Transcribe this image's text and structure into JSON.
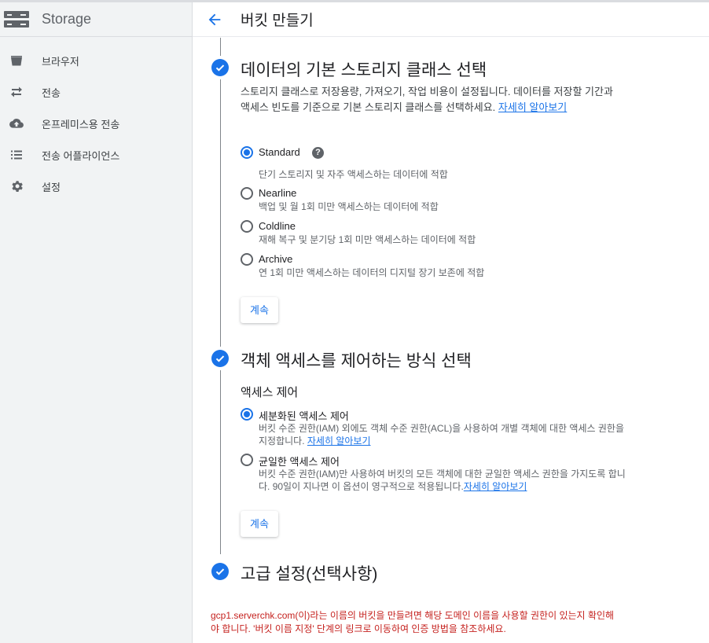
{
  "sidebar": {
    "title": "Storage",
    "items": [
      {
        "label": "브라우저",
        "icon": "bucket-icon"
      },
      {
        "label": "전송",
        "icon": "transfer-arrows-icon"
      },
      {
        "label": "온프레미스용 전송",
        "icon": "cloud-upload-icon"
      },
      {
        "label": "전송 어플라이언스",
        "icon": "list-icon"
      },
      {
        "label": "설정",
        "icon": "gear-icon"
      }
    ]
  },
  "header": {
    "title": "버킷 만들기"
  },
  "storage_class": {
    "title": "데이터의 기본 스토리지 클래스 선택",
    "description": "스토리지 클래스로 저장용량, 가져오기, 작업 비용이 설정됩니다. 데이터를 저장할 기간과 액세스 빈도를 기준으로 기본 스토리지 클래스를 선택하세요.",
    "learn_more": "자세히 알아보기",
    "options": [
      {
        "label": "Standard",
        "desc": "단기 스토리지 및 자주 액세스하는 데이터에 적합",
        "selected": true
      },
      {
        "label": "Nearline",
        "desc": "백업 및 월 1회 미만 액세스하는 데이터에 적합",
        "selected": false
      },
      {
        "label": "Coldline",
        "desc": "재해 복구 및 분기당 1회 미만 액세스하는 데이터에 적합",
        "selected": false
      },
      {
        "label": "Archive",
        "desc": "연 1회 미만 액세스하는 데이터의 디지털 장기 보존에 적합",
        "selected": false
      }
    ],
    "help_glyph": "?",
    "continue_label": "계속"
  },
  "access_control": {
    "title": "객체 액세스를 제어하는 방식 선택",
    "subheading": "액세스 제어",
    "options": [
      {
        "label": "세분화된 액세스 제어",
        "desc": "버킷 수준 권한(IAM) 외에도 객체 수준 권한(ACL)을 사용하여 개별 객체에 대한 액세스 권한을 지정합니다.",
        "link": "자세히 알아보기",
        "selected": true
      },
      {
        "label": "균일한 액세스 제어",
        "desc": "버킷 수준 권한(IAM)만 사용하여 버킷의 모든 객체에 대한 균일한 액세스 권한을 가지도록 합니다. 90일이 지나면 이 옵션이 영구적으로 적용됩니다.",
        "link": "자세히 알아보기",
        "selected": false
      }
    ],
    "continue_label": "계속"
  },
  "advanced": {
    "title": "고급 설정(선택사항)"
  },
  "warning": "gcp1.serverchk.com(이)라는 이름의 버킷을 만들려면 해당 도메인 이름을 사용할 권한이 있는지 확인해야 합니다. '버킷 이름 지정' 단계의 링크로 이동하여 인증 방법을 참조하세요.",
  "colors": {
    "accent": "#1a73e8",
    "error": "#c5221f",
    "sidebar_bg": "#f1f3f4"
  }
}
